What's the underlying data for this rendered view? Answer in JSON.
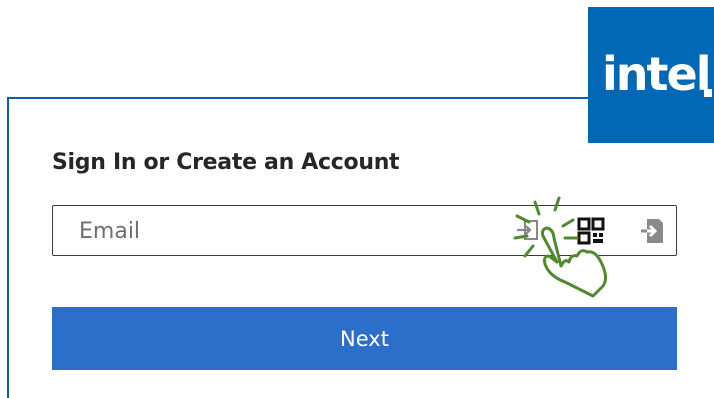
{
  "brand": {
    "logo_text": "intel",
    "logo_color": "#0068b5"
  },
  "form": {
    "title": "Sign In or Create an Account",
    "email": {
      "placeholder": "Email",
      "value": ""
    },
    "icons": {
      "passkey": "passkey-signin-icon",
      "qr": "qr-code-icon",
      "signin": "signin-arrow-icon"
    },
    "next_label": "Next",
    "accent_color": "#2b6fcb"
  },
  "overlay": {
    "pointer": "tap-hand-icon",
    "color": "#4f8a2f"
  }
}
